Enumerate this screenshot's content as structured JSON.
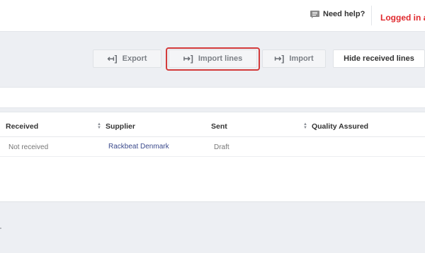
{
  "header": {
    "help_label": "Need help?",
    "help_icon": "chat-bubble-icon",
    "logged_in_text": "Logged in a"
  },
  "toolbar": {
    "export_label": "Export",
    "import_lines_label": "Import lines",
    "import_label": "Import",
    "hide_received_label": "Hide received lines",
    "highlight_color": "#d33b3b"
  },
  "table": {
    "columns": [
      {
        "label": "Received"
      },
      {
        "label": "Supplier"
      },
      {
        "label": "Sent"
      },
      {
        "label": "Quality Assured"
      }
    ],
    "rows": [
      {
        "received": "Not received",
        "supplier": "Rackbeat Denmark",
        "sent": "Draft"
      }
    ]
  },
  "colors": {
    "accent_red": "#e0282d",
    "link_blue": "#3b4a8c",
    "background": "#edeff3"
  }
}
